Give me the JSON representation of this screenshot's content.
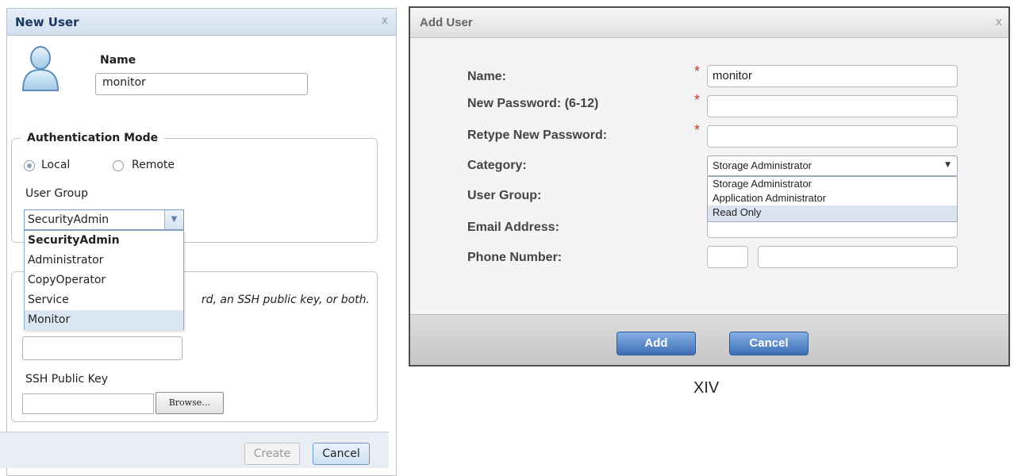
{
  "left_dialog": {
    "title": "New User",
    "close": "x",
    "name_label": "Name",
    "name_value": "monitor",
    "auth_legend": "Authentication Mode",
    "radio_local": "Local",
    "radio_remote": "Remote",
    "user_group_label": "User Group",
    "user_group_selected": "SecurityAdmin",
    "user_group_options": [
      "SecurityAdmin",
      "Administrator",
      "CopyOperator",
      "Service",
      "Monitor"
    ],
    "creds_hint": "rd, an SSH public key, or both.",
    "ssh_label": "SSH Public Key",
    "browse_label": "Browse…",
    "create_label": "Create",
    "cancel_label": "Cancel"
  },
  "right_dialog": {
    "title": "Add User",
    "close": "x",
    "name_label": "Name:",
    "name_value": "monitor",
    "new_password_label": "New Password: (6-12)",
    "retype_password_label": "Retype New Password:",
    "category_label": "Category:",
    "category_selected": "Storage Administrator",
    "category_options": [
      "Storage Administrator",
      "Application Administrator",
      "Read Only"
    ],
    "user_group_label": "User Group:",
    "email_label": "Email Address:",
    "phone_label": "Phone Number:",
    "required_mark": "*",
    "add_label": "Add",
    "cancel_label": "Cancel"
  },
  "caption": "XIV",
  "colors": {
    "left_title_text": "#1b3a63",
    "right_button_blue": "#3c6fb6",
    "required_star": "#c0392b",
    "dropdown_highlight": "#dce7f4"
  }
}
